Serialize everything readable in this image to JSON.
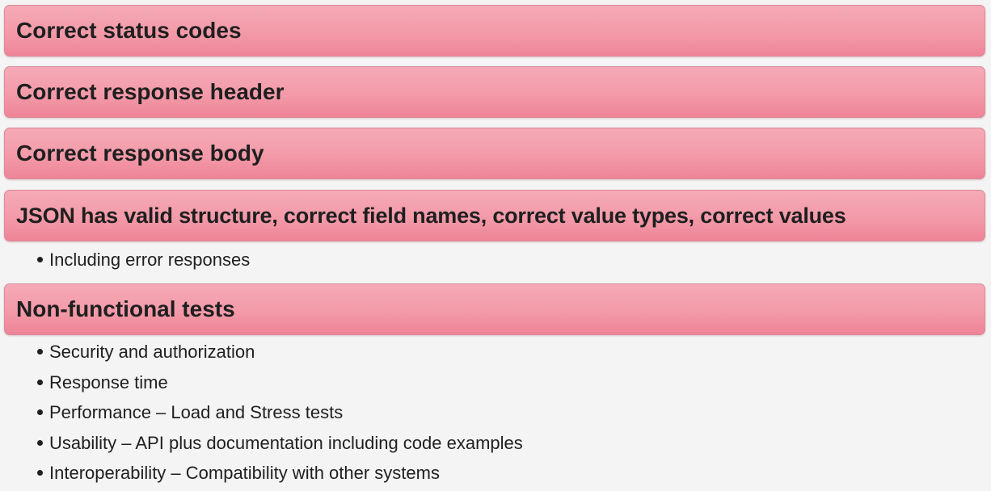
{
  "sections": [
    {
      "heading": "Correct status codes",
      "bullets": []
    },
    {
      "heading": "Correct response header",
      "bullets": []
    },
    {
      "heading": "Correct response body",
      "bullets": []
    },
    {
      "heading": "JSON has valid structure, correct field names, correct value types, correct values",
      "bullets": [
        "Including error responses"
      ]
    },
    {
      "heading": "Non-functional tests",
      "bullets": [
        "Security and authorization",
        "Response time",
        "Performance – Load and Stress tests",
        "Usability – API plus documentation including code examples",
        "Interoperability – Compatibility with other systems"
      ]
    }
  ]
}
